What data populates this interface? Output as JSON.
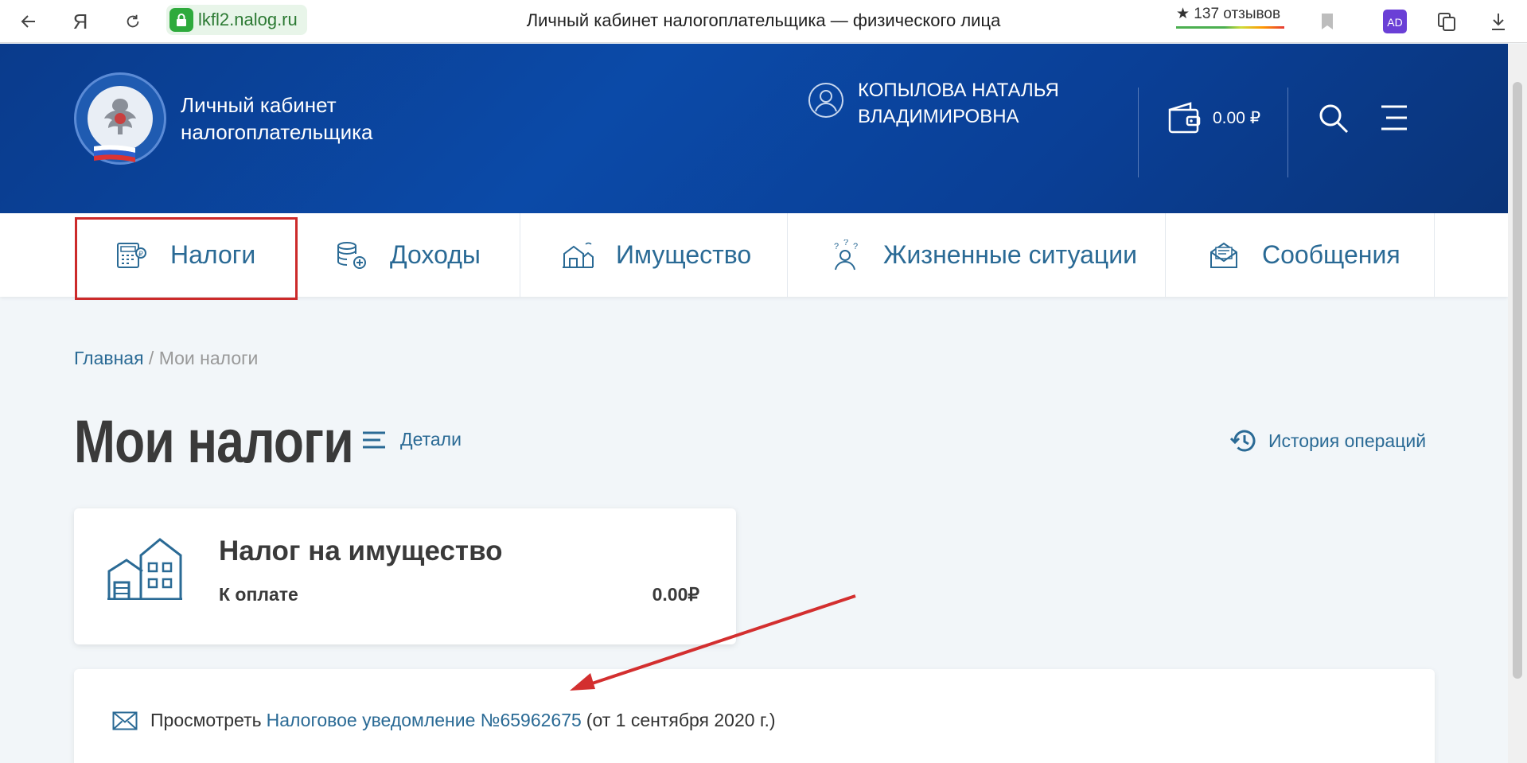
{
  "browser": {
    "url": "lkfl2.nalog.ru",
    "tab_title": "Личный кабинет налогоплательщика — физического лица",
    "reviews": "★ 137 отзывов",
    "yandex_glyph": "Я"
  },
  "header": {
    "logo_text": [
      "Личный кабинет",
      "налогоплательщика"
    ],
    "user_name": [
      "КОПЫЛОВА НАТАЛЬЯ",
      "ВЛАДИМИРОВНА"
    ],
    "balance": "0.00 ₽"
  },
  "nav": {
    "items": [
      {
        "label": "Налоги",
        "icon": "calculator-icon"
      },
      {
        "label": "Доходы",
        "icon": "coins-icon"
      },
      {
        "label": "Имущество",
        "icon": "property-icon"
      },
      {
        "label": "Жизненные ситуации",
        "icon": "person-question-icon"
      },
      {
        "label": "Сообщения",
        "icon": "message-icon"
      }
    ],
    "highlight_color": "#cc2a2a"
  },
  "breadcrumb": {
    "home": "Главная",
    "separator": " / ",
    "current": "Мои налоги"
  },
  "page": {
    "title": "Мои налоги",
    "details": "Детали",
    "history": "История операций"
  },
  "tax_card": {
    "title": "Налог на имущество",
    "label": "К оплате",
    "amount": "0.00₽"
  },
  "notice": {
    "prefix": "Просмотреть",
    "link": "Налоговое уведомление №65962675",
    "suffix": "(от 1 сентября 2020 г.)"
  },
  "colors": {
    "header_blue": "#0b4aa8",
    "link_blue": "#2a6a95",
    "annotation_red": "#d32f2f"
  }
}
